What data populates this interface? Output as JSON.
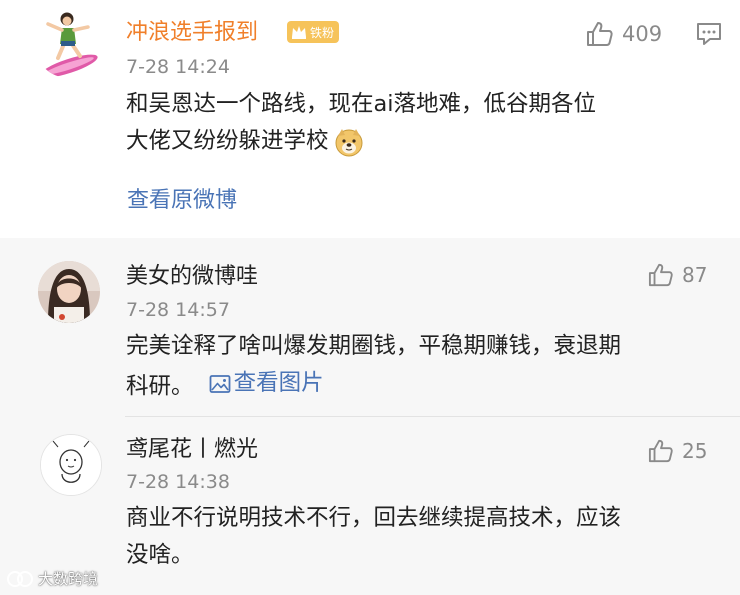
{
  "colors": {
    "orange_name": "#f07f2a",
    "link_blue": "#4a74b6",
    "text": "#222222",
    "muted": "#8a8a8a",
    "badge_gold": "#f6c35a"
  },
  "post": {
    "author": "冲浪选手报到",
    "badge_text": "铁粉",
    "badge_icon": "crown-icon",
    "timestamp": "7-28 14:24",
    "line1": "和吴恩达一个路线，现在ai落地难，低谷期各位",
    "line2": "大佬又纷纷躲进学校",
    "emoji_icon": "doge-emoji-icon",
    "likes": "409",
    "view_original": "查看原微博"
  },
  "comments": [
    {
      "author": "美女的微博哇",
      "timestamp": "7-28 14:57",
      "line1": "完美诠释了啥叫爆发期圈钱，平稳期赚钱，衰退期",
      "line2": "科研。",
      "view_image": "查看图片",
      "likes": "87"
    },
    {
      "author": "鸢尾花丨燃光",
      "timestamp": "7-28 14:38",
      "line1": "商业不行说明技术不行，回去继续提高技术，应该",
      "line2": "没啥。",
      "likes": "25"
    }
  ],
  "watermark": "大数跨境"
}
